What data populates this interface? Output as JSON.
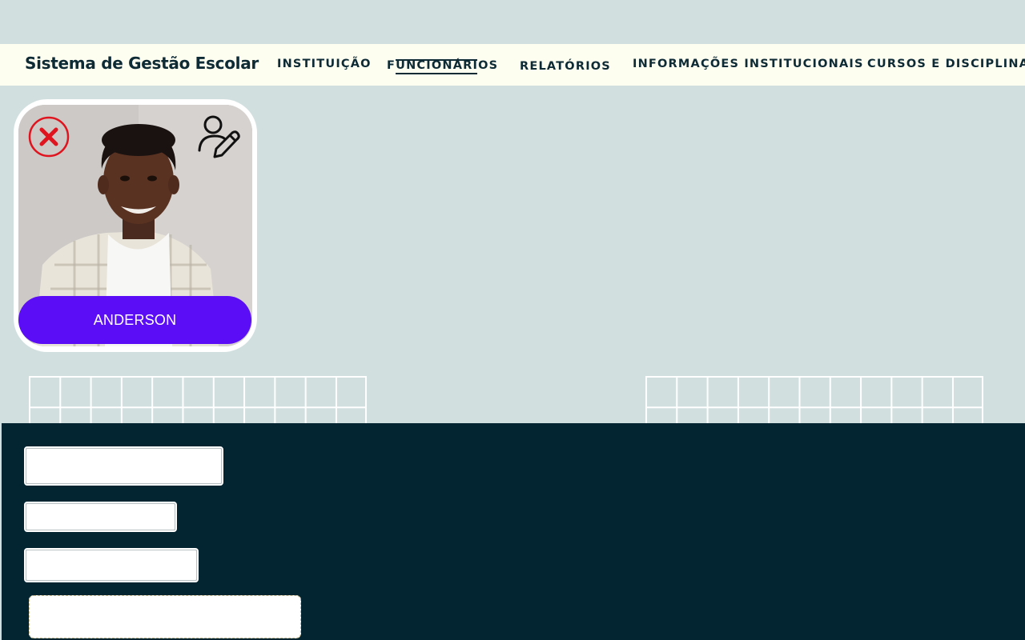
{
  "app": {
    "title": "Sistema de Gestão Escolar"
  },
  "nav": {
    "items": [
      {
        "label": "INSTITUIÇÃO"
      },
      {
        "label": "FUNCIONÁRIOS",
        "active": true
      },
      {
        "label": "RELATÓRIOS"
      },
      {
        "label": "INFORMAÇÕES INSTITUCIONAIS"
      },
      {
        "label": "CURSOS E DISCIPLINAS"
      }
    ]
  },
  "employee_card": {
    "name": "ANDERSON",
    "remove_icon": "close-circle-icon",
    "edit_icon": "user-edit-icon"
  },
  "form": {
    "fields": [
      {
        "value": "",
        "placeholder": ""
      },
      {
        "value": "",
        "placeholder": ""
      },
      {
        "value": "",
        "placeholder": ""
      },
      {
        "value": "",
        "placeholder": ""
      }
    ]
  },
  "colors": {
    "background": "#d2dfdf",
    "topbar": "#fdfdf0",
    "panel": "#032532",
    "accent": "#5b0df5",
    "danger": "#e0141e",
    "text": "#0d2a35"
  }
}
